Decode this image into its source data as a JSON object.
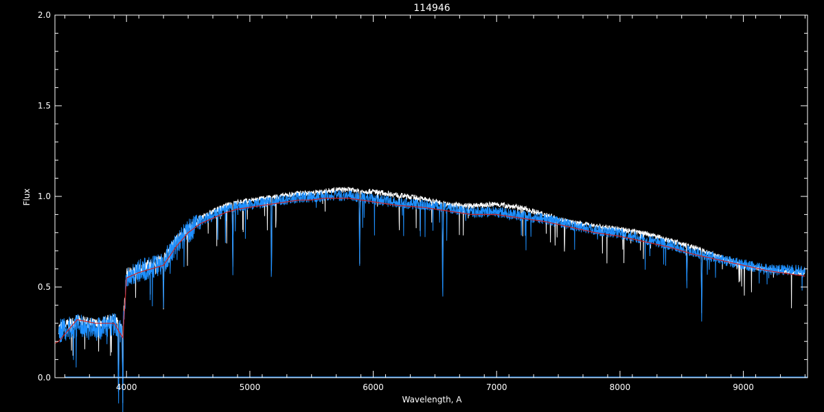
{
  "chart_data": {
    "type": "line",
    "title": "114946",
    "xlabel": "Wavelength, A",
    "ylabel": "Flux",
    "xlim": [
      3420,
      9520
    ],
    "ylim": [
      0.0,
      2.0
    ],
    "x_ticks": [
      4000,
      5000,
      6000,
      7000,
      8000,
      9000
    ],
    "x_tick_labels": [
      "4000",
      "5000",
      "6000",
      "7000",
      "8000",
      "9000"
    ],
    "y_ticks": [
      0.0,
      0.5,
      1.0,
      1.5,
      2.0
    ],
    "y_tick_labels": [
      "0.0",
      "0.5",
      "1.0",
      "1.5",
      "2.0"
    ],
    "grid": false,
    "background": "#000000",
    "series": [
      {
        "color": "#ffffff",
        "noise": 0.03,
        "x": [
          3450,
          3600,
          3750,
          3900,
          3970,
          4000,
          4100,
          4200,
          4300,
          4400,
          4500,
          4600,
          4700,
          4800,
          4900,
          5000,
          5100,
          5200,
          5300,
          5400,
          5500,
          5600,
          5700,
          5800,
          5900,
          6000,
          6200,
          6400,
          6600,
          6800,
          7000,
          7200,
          7400,
          7600,
          7800,
          8000,
          8200,
          8400,
          8600,
          8800,
          9000,
          9200,
          9500
        ],
        "y": [
          0.28,
          0.32,
          0.3,
          0.33,
          0.28,
          0.58,
          0.6,
          0.63,
          0.66,
          0.76,
          0.82,
          0.88,
          0.92,
          0.95,
          0.97,
          0.98,
          0.99,
          1.0,
          1.01,
          1.02,
          1.02,
          1.03,
          1.04,
          1.04,
          1.03,
          1.03,
          1.01,
          0.99,
          0.96,
          0.95,
          0.96,
          0.94,
          0.9,
          0.86,
          0.84,
          0.82,
          0.8,
          0.76,
          0.72,
          0.67,
          0.62,
          0.6,
          0.58
        ]
      },
      {
        "color": "#1e90ff",
        "noise": 0.06,
        "x": [
          3450,
          3600,
          3750,
          3900,
          3970,
          4000,
          4100,
          4200,
          4300,
          4400,
          4500,
          4600,
          4700,
          4800,
          4900,
          5000,
          5100,
          5200,
          5300,
          5400,
          5500,
          5600,
          5700,
          5800,
          5900,
          6000,
          6200,
          6400,
          6600,
          6800,
          7000,
          7200,
          7400,
          7600,
          7800,
          8000,
          8200,
          8400,
          8600,
          8800,
          9000,
          9200,
          9500
        ],
        "y": [
          0.27,
          0.3,
          0.28,
          0.31,
          0.25,
          0.57,
          0.6,
          0.62,
          0.65,
          0.75,
          0.82,
          0.87,
          0.9,
          0.93,
          0.95,
          0.96,
          0.97,
          0.98,
          0.99,
          1.0,
          1.0,
          1.01,
          1.01,
          1.01,
          1.0,
          0.99,
          0.97,
          0.96,
          0.94,
          0.92,
          0.92,
          0.9,
          0.88,
          0.85,
          0.82,
          0.8,
          0.77,
          0.74,
          0.7,
          0.66,
          0.63,
          0.6,
          0.6
        ]
      },
      {
        "color": "#cc2222",
        "noise": 0.0,
        "x": [
          3420,
          3450,
          3600,
          3750,
          3900,
          3970,
          4000,
          4100,
          4200,
          4300,
          4400,
          4500,
          4600,
          4700,
          4800,
          4900,
          5000,
          5100,
          5200,
          5300,
          5400,
          5500,
          5600,
          5700,
          5800,
          5900,
          6000,
          6200,
          6400,
          6600,
          6800,
          7000,
          7200,
          7400,
          7600,
          7800,
          8000,
          8200,
          8400,
          8600,
          8800,
          9000,
          9200,
          9500
        ],
        "y": [
          0.19,
          0.2,
          0.32,
          0.3,
          0.3,
          0.22,
          0.55,
          0.58,
          0.6,
          0.62,
          0.72,
          0.8,
          0.85,
          0.88,
          0.91,
          0.93,
          0.94,
          0.95,
          0.96,
          0.97,
          0.98,
          0.98,
          0.99,
          0.99,
          0.99,
          0.98,
          0.97,
          0.95,
          0.94,
          0.92,
          0.9,
          0.9,
          0.88,
          0.86,
          0.83,
          0.8,
          0.78,
          0.75,
          0.72,
          0.68,
          0.65,
          0.62,
          0.59,
          0.56
        ]
      }
    ],
    "absorption_lines": [
      {
        "x": 3935,
        "depth": 0.45
      },
      {
        "x": 3970,
        "depth": 0.4
      },
      {
        "x": 4300,
        "depth": 0.25
      },
      {
        "x": 4862,
        "depth": 0.35
      },
      {
        "x": 5175,
        "depth": 0.5
      },
      {
        "x": 5890,
        "depth": 0.4
      },
      {
        "x": 6563,
        "depth": 0.55
      },
      {
        "x": 8542,
        "depth": 0.2
      },
      {
        "x": 8662,
        "depth": 0.35
      }
    ]
  }
}
